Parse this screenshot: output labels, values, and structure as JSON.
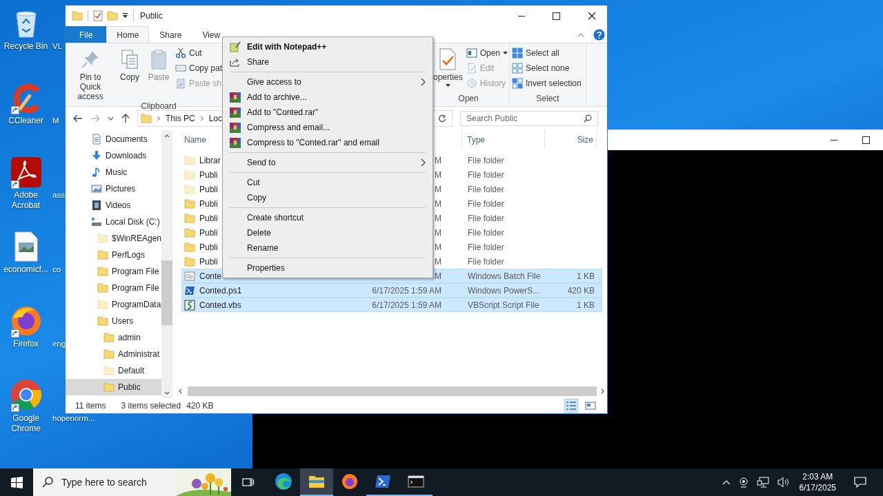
{
  "desktop_icons": [
    {
      "label": "Recycle Bin",
      "shortcut": false
    },
    {
      "label": "CCleaner",
      "shortcut": true
    },
    {
      "label": "Adobe Acrobat",
      "shortcut": true
    },
    {
      "label": "economicf...",
      "shortcut": false
    },
    {
      "label": "Firefox",
      "shortcut": true
    },
    {
      "label": "Google Chrome",
      "shortcut": true
    }
  ],
  "desktop_icons_column_2": [
    "VL",
    "M",
    "ass",
    "co",
    "eng",
    "hopenorm..."
  ],
  "explorer": {
    "title": "Public",
    "ribbon_tabs": [
      {
        "label": "File",
        "kind": "file",
        "selected": false
      },
      {
        "label": "Home",
        "kind": "tab",
        "selected": true
      },
      {
        "label": "Share",
        "kind": "tab",
        "selected": false
      },
      {
        "label": "View",
        "kind": "tab",
        "selected": false
      }
    ],
    "clipboard": {
      "label": "Clipboard",
      "large": [
        {
          "label": "Pin to Quick access",
          "disabled": false
        },
        {
          "label": "Copy",
          "disabled": false
        },
        {
          "label": "Paste",
          "disabled": true
        }
      ],
      "small": [
        {
          "label": "Cut",
          "disabled": false
        },
        {
          "label": "Copy pat",
          "disabled": false
        },
        {
          "label": "Paste sh",
          "disabled": true
        }
      ]
    },
    "open": {
      "label": "Open",
      "properties": "operties",
      "small": [
        {
          "label": "Open",
          "dropdown": true,
          "disabled": false
        },
        {
          "label": "Edit",
          "dropdown": false,
          "disabled": true
        },
        {
          "label": "History",
          "dropdown": false,
          "disabled": true
        }
      ]
    },
    "select": {
      "label": "Select",
      "small": [
        {
          "label": "Select all"
        },
        {
          "label": "Select none"
        },
        {
          "label": "Invert selection"
        }
      ]
    },
    "crumbs": [
      "This PC",
      "Loc"
    ],
    "search": {
      "placeholder": "Search Public"
    },
    "nav": [
      {
        "label": "Documents",
        "selected": false
      },
      {
        "label": "Downloads",
        "selected": false
      },
      {
        "label": "Music",
        "selected": false
      },
      {
        "label": "Pictures",
        "selected": false
      },
      {
        "label": "Videos",
        "selected": false
      },
      {
        "label": "Local Disk (C:)",
        "selected": false,
        "children": [
          {
            "label": "$WinREAgen",
            "hidden": true,
            "selected": false
          },
          {
            "label": "PerfLogs",
            "hidden": false,
            "selected": false
          },
          {
            "label": "Program File",
            "hidden": false,
            "selected": false
          },
          {
            "label": "Program File",
            "hidden": false,
            "selected": false
          },
          {
            "label": "ProgramData",
            "hidden": true,
            "selected": false
          },
          {
            "label": "Users",
            "hidden": false,
            "selected": false,
            "children": [
              {
                "label": "admin",
                "hidden": false,
                "selected": false
              },
              {
                "label": "Administrat",
                "hidden": false,
                "selected": false
              },
              {
                "label": "Default",
                "hidden": true,
                "selected": false
              },
              {
                "label": "Public",
                "hidden": false,
                "selected": true
              }
            ]
          }
        ]
      }
    ],
    "columns": {
      "name": "Name",
      "type": "Type",
      "size": "Size"
    },
    "rows": [
      {
        "name": "Librar",
        "date": "M",
        "type": "File folder",
        "kind": "folder",
        "hidden": true,
        "selected": false
      },
      {
        "name": "Publi",
        "date": "M",
        "type": "File folder",
        "kind": "folder",
        "hidden": true,
        "selected": false
      },
      {
        "name": "Publi",
        "date": "M",
        "type": "File folder",
        "kind": "folder",
        "hidden": true,
        "selected": false
      },
      {
        "name": "Publi",
        "date": "M",
        "type": "File folder",
        "kind": "folder",
        "hidden": false,
        "selected": false
      },
      {
        "name": "Publi",
        "date": "M",
        "type": "File folder",
        "kind": "folder",
        "hidden": false,
        "selected": false
      },
      {
        "name": "Publi",
        "date": "M",
        "type": "File folder",
        "kind": "folder",
        "hidden": false,
        "selected": false
      },
      {
        "name": "Publi",
        "date": "M",
        "type": "File folder",
        "kind": "folder",
        "hidden": false,
        "selected": false
      },
      {
        "name": "Publi",
        "date": "M",
        "type": "File folder",
        "kind": "folder",
        "hidden": false,
        "selected": false
      },
      {
        "name": "Conte",
        "date": "M",
        "type": "Windows Batch File",
        "size": "1 KB",
        "kind": "batch",
        "hidden": false,
        "selected": true
      },
      {
        "name": "Conted.ps1",
        "date": "6/17/2025 1:59 AM",
        "type": "Windows PowerS...",
        "size": "420 KB",
        "kind": "powershell",
        "hidden": false,
        "selected": true
      },
      {
        "name": "Conted.vbs",
        "date": "6/17/2025 1:59 AM",
        "type": "VBScript Script File",
        "size": "1 KB",
        "kind": "vbscript",
        "hidden": false,
        "selected": true
      }
    ],
    "status": {
      "item_count": "11 items",
      "selection": "3 items selected",
      "size": "420 KB"
    },
    "views": [
      {
        "selected": true
      },
      {
        "selected": false
      }
    ]
  },
  "context_menu": {
    "sections": [
      [
        {
          "label": "Edit with Notepad++",
          "default": true,
          "submenu": false
        },
        {
          "label": "Share",
          "default": false,
          "submenu": false
        }
      ],
      [
        {
          "label": "Give access to",
          "default": false,
          "submenu": true
        },
        {
          "label": "Add to archive...",
          "default": false,
          "submenu": false
        },
        {
          "label": "Add to \"Conted.rar\"",
          "default": false,
          "submenu": false
        },
        {
          "label": "Compress and email...",
          "default": false,
          "submenu": false
        },
        {
          "label": "Compress to \"Conted.rar\" and email",
          "default": false,
          "submenu": false
        }
      ],
      [
        {
          "label": "Send to",
          "default": false,
          "submenu": true
        }
      ],
      [
        {
          "label": "Cut",
          "default": false,
          "submenu": false
        },
        {
          "label": "Copy",
          "default": false,
          "submenu": false
        }
      ],
      [
        {
          "label": "Create shortcut",
          "default": false,
          "submenu": false
        },
        {
          "label": "Delete",
          "default": false,
          "submenu": false
        },
        {
          "label": "Rename",
          "default": false,
          "submenu": false
        }
      ],
      [
        {
          "label": "Properties",
          "default": false,
          "submenu": false
        }
      ]
    ]
  },
  "taskbar": {
    "search_placeholder": "Type here to search",
    "apps": [
      {
        "running": false,
        "selected": false
      },
      {
        "running": true,
        "selected": true
      },
      {
        "running": false,
        "selected": false
      },
      {
        "running": true,
        "selected": false
      },
      {
        "running": true,
        "selected": false
      }
    ],
    "time": "2:03 AM",
    "date": "6/17/2025"
  }
}
